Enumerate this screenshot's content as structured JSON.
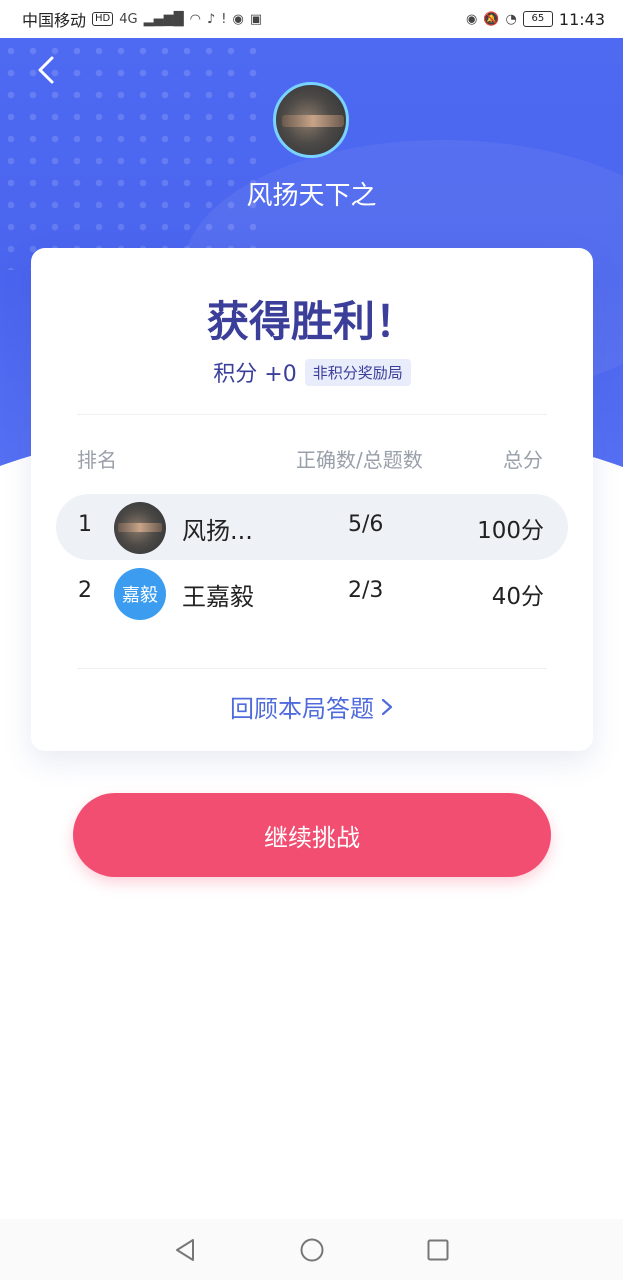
{
  "status_bar": {
    "carrier": "中国移动",
    "hd": "HD",
    "network": "4G",
    "battery": "65",
    "time": "11:43"
  },
  "profile": {
    "name": "风扬天下之"
  },
  "result": {
    "title": "获得胜利！",
    "score": "积分 +0",
    "tag": "非积分奖励局"
  },
  "table": {
    "headers": {
      "rank": "排名",
      "correct": "正确数/总题数",
      "total": "总分"
    },
    "rows": [
      {
        "rank": "1",
        "name": "风扬...",
        "correct": "5/6",
        "total": "100分"
      },
      {
        "rank": "2",
        "avatar_text": "嘉毅",
        "name": "王嘉毅",
        "correct": "2/3",
        "total": "40分"
      }
    ]
  },
  "review_link": "回顾本局答题",
  "continue_button": "继续挑战",
  "colors": {
    "primary_blue": "#4f6bf2",
    "title_navy": "#3b3f9a",
    "button_pink": "#f24e72",
    "avatar_blue": "#3b9cf0"
  }
}
